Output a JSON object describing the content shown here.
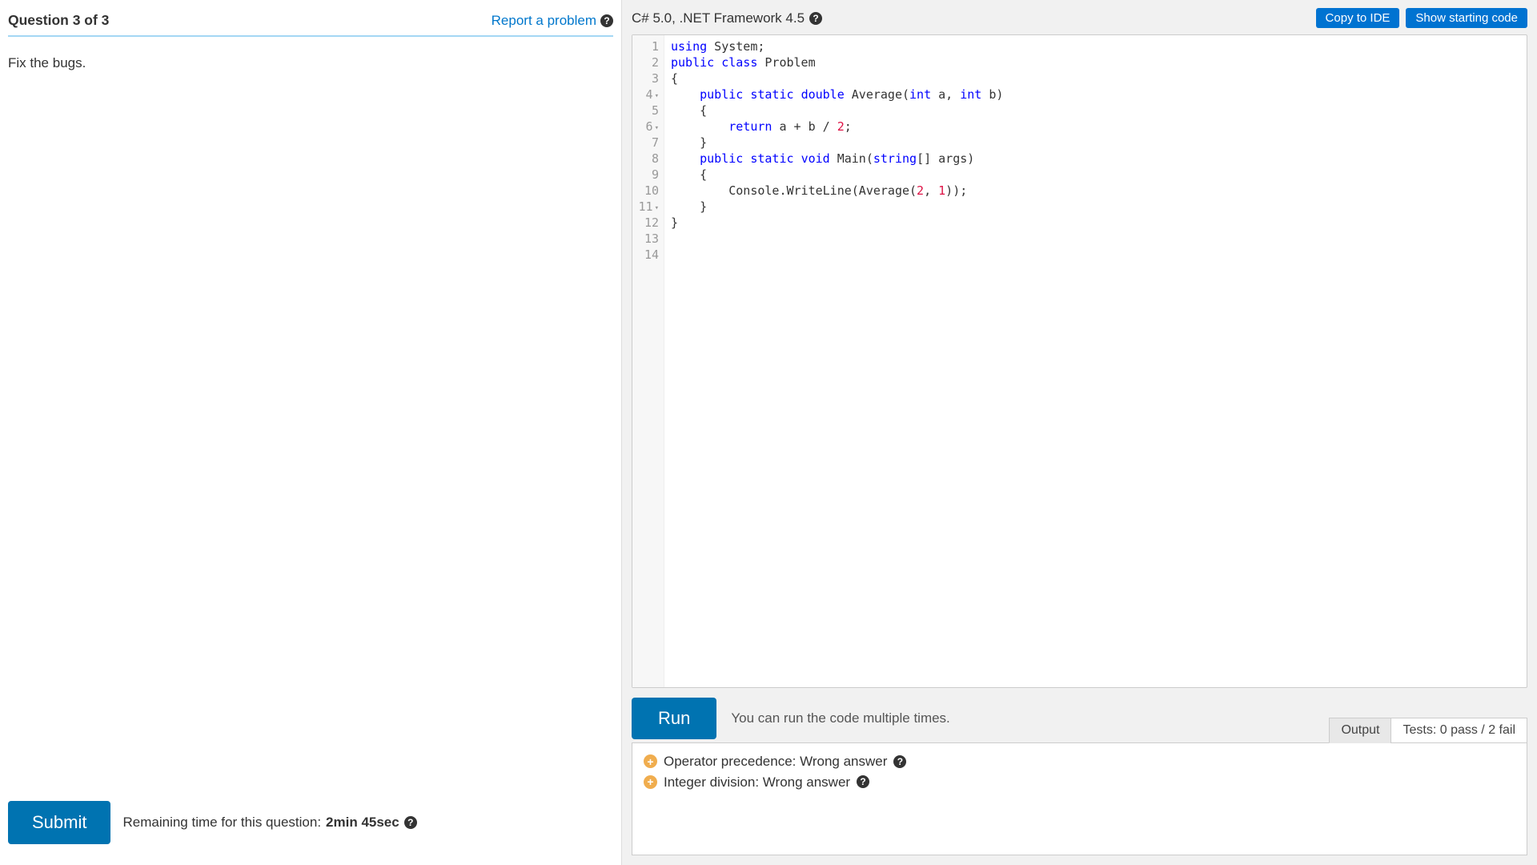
{
  "question": {
    "title": "Question 3 of 3",
    "report_label": "Report a problem",
    "body": "Fix the bugs."
  },
  "footer": {
    "submit_label": "Submit",
    "remaining_prefix": "Remaining time for this question: ",
    "remaining_time": "2min 45sec"
  },
  "env": {
    "label": "C# 5.0, .NET Framework 4.5",
    "copy_label": "Copy to IDE",
    "starting_label": "Show starting code"
  },
  "code_lines": [
    {
      "n": 1,
      "fold": false,
      "tokens": [
        [
          "kw",
          "using"
        ],
        [
          "",
          " System;"
        ]
      ]
    },
    {
      "n": 2,
      "fold": false,
      "tokens": [
        [
          "",
          ""
        ]
      ]
    },
    {
      "n": 3,
      "fold": false,
      "tokens": [
        [
          "kw",
          "public"
        ],
        [
          "",
          " "
        ],
        [
          "kw",
          "class"
        ],
        [
          "",
          " Problem"
        ]
      ]
    },
    {
      "n": 4,
      "fold": true,
      "tokens": [
        [
          "",
          "{"
        ]
      ]
    },
    {
      "n": 5,
      "fold": false,
      "tokens": [
        [
          "",
          "    "
        ],
        [
          "kw",
          "public"
        ],
        [
          "",
          " "
        ],
        [
          "kw",
          "static"
        ],
        [
          "",
          " "
        ],
        [
          "kw",
          "double"
        ],
        [
          "",
          " Average("
        ],
        [
          "kw",
          "int"
        ],
        [
          "",
          " a, "
        ],
        [
          "kw",
          "int"
        ],
        [
          "",
          " b)"
        ]
      ]
    },
    {
      "n": 6,
      "fold": true,
      "tokens": [
        [
          "",
          "    {"
        ]
      ]
    },
    {
      "n": 7,
      "fold": false,
      "tokens": [
        [
          "",
          "        "
        ],
        [
          "kw",
          "return"
        ],
        [
          "",
          " a + b / "
        ],
        [
          "num",
          "2"
        ],
        [
          "",
          ";"
        ]
      ]
    },
    {
      "n": 8,
      "fold": false,
      "tokens": [
        [
          "",
          "    }"
        ]
      ]
    },
    {
      "n": 9,
      "fold": false,
      "tokens": [
        [
          "",
          ""
        ]
      ]
    },
    {
      "n": 10,
      "fold": false,
      "tokens": [
        [
          "",
          "    "
        ],
        [
          "kw",
          "public"
        ],
        [
          "",
          " "
        ],
        [
          "kw",
          "static"
        ],
        [
          "",
          " "
        ],
        [
          "kw",
          "void"
        ],
        [
          "",
          " Main("
        ],
        [
          "kw",
          "string"
        ],
        [
          "",
          "[] args)"
        ]
      ]
    },
    {
      "n": 11,
      "fold": true,
      "tokens": [
        [
          "",
          "    {"
        ]
      ]
    },
    {
      "n": 12,
      "fold": false,
      "tokens": [
        [
          "",
          "        Console.WriteLine(Average("
        ],
        [
          "num",
          "2"
        ],
        [
          "",
          ", "
        ],
        [
          "num",
          "1"
        ],
        [
          "",
          "));"
        ]
      ]
    },
    {
      "n": 13,
      "fold": false,
      "tokens": [
        [
          "",
          "    }"
        ]
      ]
    },
    {
      "n": 14,
      "fold": false,
      "tokens": [
        [
          "",
          "}"
        ]
      ]
    }
  ],
  "run": {
    "label": "Run",
    "hint": "You can run the code multiple times."
  },
  "tabs": {
    "output": "Output",
    "tests": "Tests: 0 pass / 2 fail"
  },
  "test_results": [
    {
      "label": "Operator precedence: Wrong answer"
    },
    {
      "label": "Integer division: Wrong answer"
    }
  ]
}
